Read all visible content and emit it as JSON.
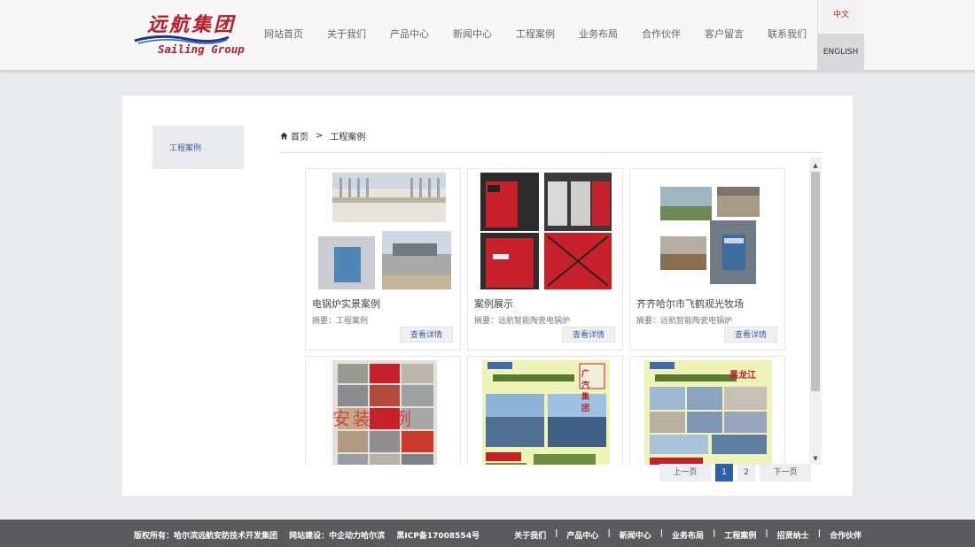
{
  "header": {
    "logo_cn": "远航集团",
    "logo_en": "Sailing Group",
    "nav": [
      "网站首页",
      "关于我们",
      "产品中心",
      "新闻中心",
      "工程案例",
      "业务布局",
      "合作伙伴",
      "客户留言",
      "联系我们"
    ],
    "lang_cn": "中文",
    "lang_en": "ENGLISH"
  },
  "sidebar": {
    "item": "工程案例"
  },
  "breadcrumb": {
    "home": "首页",
    "separator": ">",
    "current": "工程案例"
  },
  "cards": [
    {
      "title": "电锅炉实景案例",
      "summary": "摘要：工程案例",
      "button": "查看详情"
    },
    {
      "title": "案例展示",
      "summary": "摘要：远航智能陶瓷电锅炉",
      "button": "查看详情"
    },
    {
      "title": "齐齐哈尔市飞鹤观光牧场",
      "summary": "摘要：远航智能陶瓷电锅炉",
      "button": "查看详情"
    },
    {
      "title": "",
      "summary": "",
      "button": "",
      "overlay": "安装案例"
    },
    {
      "title": "",
      "summary": "",
      "button": "",
      "overlay": "广汽集团"
    },
    {
      "title": "",
      "summary": "",
      "button": "",
      "overlay": "黑龙江"
    }
  ],
  "pager": {
    "prev": "上一页",
    "pages": [
      "1",
      "2"
    ],
    "active": "1",
    "next": "下一页"
  },
  "footer": {
    "copyright": "版权所有：哈尔滨远航安防技术开发集团",
    "builder": "网站建设：中企动力哈尔滨",
    "icp": "黑ICP备17008554号",
    "links": [
      "关于我们",
      "产品中心",
      "新闻中心",
      "业务布局",
      "工程案例",
      "招贤纳士",
      "合作伙伴"
    ]
  },
  "colors": {
    "brand": "#b51f2b",
    "link": "#3a5f98",
    "active_page": "#2e5fa6",
    "footer_bg": "#5a5a5c"
  }
}
